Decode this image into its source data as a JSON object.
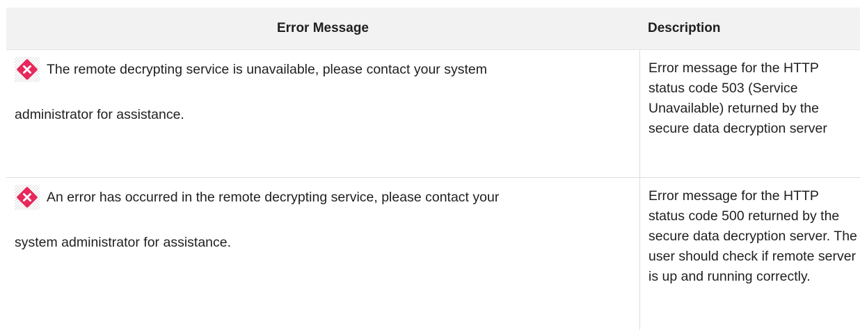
{
  "table": {
    "headers": {
      "error_message": "Error Message",
      "description": "Description"
    },
    "rows": [
      {
        "icon": "error-icon",
        "message_line1": "The remote decrypting service is unavailable, please contact your system",
        "message_line2": "administrator for assistance.",
        "description": "Error message for the HTTP status code 503 (Service Unavailable) returned by the secure data decryption server"
      },
      {
        "icon": "error-icon",
        "message_line1": "An error has occurred in the remote decrypting service, please contact your",
        "message_line2": "system administrator for assistance.",
        "description": "Error message for the HTTP status code 500 returned by the secure data decryption server. The user should check if remote server is up and running correctly."
      }
    ]
  },
  "colors": {
    "header_bg": "#f2f2f2",
    "error_icon": "#e8275a",
    "border": "#dcdcdc"
  }
}
